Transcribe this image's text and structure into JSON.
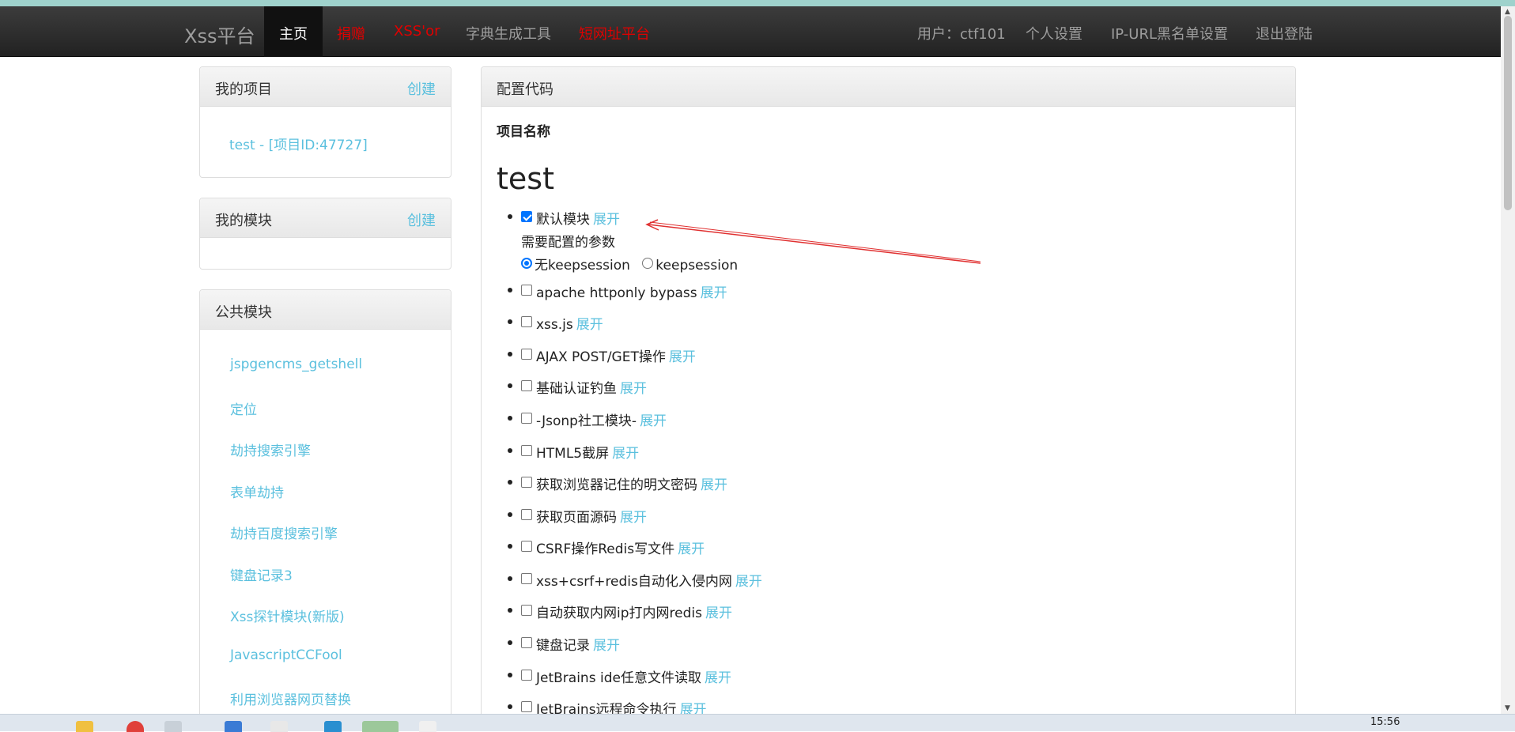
{
  "navbar": {
    "brand": "Xss平台",
    "items": [
      "主页",
      "捐赠",
      "XSS'or",
      "字典生成工具",
      "短网址平台"
    ],
    "right_items": [
      "用户：ctf101",
      "个人设置",
      "IP-URL黑名单设置",
      "退出登陆"
    ]
  },
  "sidebar": {
    "my_projects": {
      "title": "我的项目",
      "action": "创建",
      "items": [
        "test - [项目ID:47727]"
      ]
    },
    "my_modules": {
      "title": "我的模块",
      "action": "创建"
    },
    "public_modules": {
      "title": "公共模块",
      "items": [
        "jspgencms_getshell",
        "定位",
        "劫持搜索引擎",
        "表单劫持",
        "劫持百度搜索引擎",
        "键盘记录3",
        "Xss探针模块(新版)",
        "JavascriptCCFool",
        "利用浏览器网页替换"
      ]
    }
  },
  "main": {
    "panel_title": "配置代码",
    "project_label": "项目名称",
    "project_name": "test",
    "expand_label": "展开",
    "default_module": {
      "name": "默认模块",
      "checked": true,
      "param_label": "需要配置的参数",
      "options": [
        "无keepsession",
        "keepsession"
      ],
      "selected": "无keepsession"
    },
    "modules": [
      "apache httponly bypass",
      "xss.js",
      "AJAX POST/GET操作",
      "基础认证钓鱼",
      "-Jsonp社工模块-",
      "HTML5截屏",
      "获取浏览器记住的明文密码",
      "获取页面源码",
      "CSRF操作Redis写文件",
      "xss+csrf+redis自动化入侵内网",
      "自动获取内网ip打内网redis",
      "键盘记录",
      "JetBrains ide任意文件读取",
      "JetBrains远程命令执行"
    ]
  },
  "taskbar": {
    "clock": "15:56"
  },
  "colors": {
    "accent_link": "#5bc0de",
    "nav_red": "#e00000",
    "navbar_bg": "#222222",
    "annotation_arrow": "#e03030"
  }
}
